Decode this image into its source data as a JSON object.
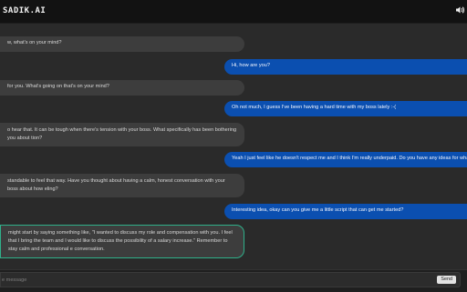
{
  "app": {
    "title": "SADIK.AI"
  },
  "header": {
    "sound_icon": "speaker-volume-icon"
  },
  "messages": [
    {
      "role": "bot",
      "text": "w, what's on your mind?"
    },
    {
      "role": "user",
      "text": "Hi, how are you?"
    },
    {
      "role": "bot",
      "text": "for you. What's going on that's on your mind?"
    },
    {
      "role": "user",
      "text": "Oh not much, I guess I've been having a hard time with my boss lately :-("
    },
    {
      "role": "bot",
      "text": "o hear that. It can be tough when there's tension with your boss. What specifically has been bothering you about tion?"
    },
    {
      "role": "user",
      "text": "Yeah I just feel like he doesn't respect me and I think I'm really underpaid. Do you have any ideas for what I should"
    },
    {
      "role": "bot",
      "text": "standable to feel that way. Have you thought about having a calm, honest conversation with your boss about how eling?"
    },
    {
      "role": "user",
      "text": "Interesting idea, okay can you give me a little script that can get me started?"
    },
    {
      "role": "bot",
      "text": "might start by saying something like, \"I wanted to discuss my role and compensation with you. I feel that I bring the team and I would like to discuss the possibility of a salary increase.\" Remember to stay calm and professional e conversation."
    }
  ],
  "composer": {
    "placeholder": "e message",
    "value": "",
    "send_label": "Send"
  },
  "colors": {
    "user_bubble": "#0b4fb0",
    "bot_bubble": "#3d3d3d",
    "focus_border": "#2fb08a"
  }
}
